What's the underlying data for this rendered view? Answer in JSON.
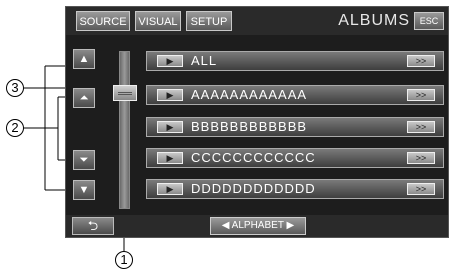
{
  "topbar": {
    "source_label": "SOURCE",
    "visual_label": "VISUAL",
    "setup_label": "SETUP",
    "title": "ALBUMS",
    "esc_label": "ESC"
  },
  "scroll": {
    "page_up_glyph": "▲",
    "line_up_glyph": "⏶",
    "line_down_glyph": "⏷",
    "page_down_glyph": "▼"
  },
  "list": {
    "play_glyph": "▶",
    "more_glyph": ">>",
    "items": [
      {
        "label": "ALL"
      },
      {
        "label": "AAAAAAAAAAAA"
      },
      {
        "label": "BBBBBBBBBBBB"
      },
      {
        "label": "CCCCCCCCCCCC"
      },
      {
        "label": "DDDDDDDDDDDD"
      }
    ]
  },
  "bottombar": {
    "back_glyph": "⮌",
    "alphabet_label": "◀ ALPHABET ▶"
  },
  "callouts": {
    "one": "1",
    "two": "2",
    "three": "3"
  }
}
